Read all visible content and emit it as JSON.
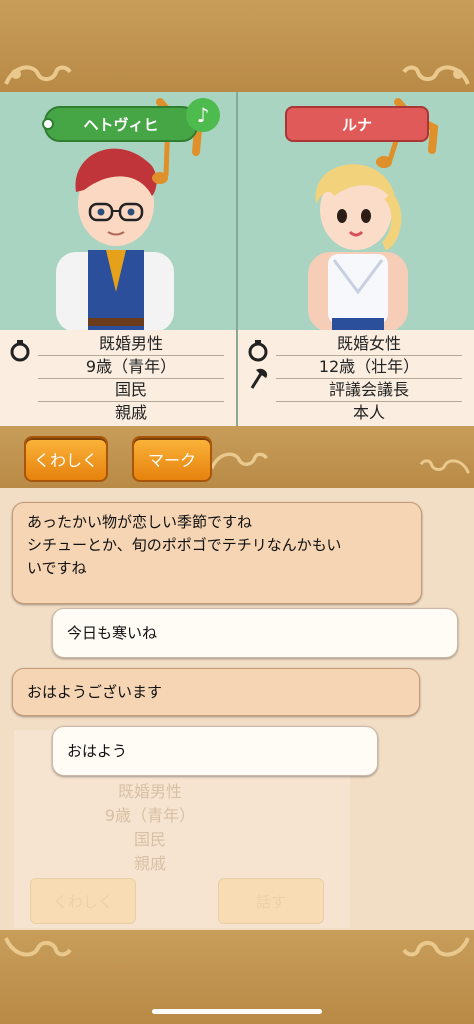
{
  "characters": [
    {
      "name": "ヘトヴィヒ",
      "tag_color": "#46a646",
      "has_note": true,
      "info": [
        "既婚男性",
        "9歳（青年）",
        "国民",
        "親戚"
      ],
      "icons": [
        "ring-icon"
      ]
    },
    {
      "name": "ルナ",
      "tag_color": "#e05a5a",
      "has_note": false,
      "info": [
        "既婚女性",
        "12歳（壮年）",
        "評議会議長",
        "本人"
      ],
      "icons": [
        "ring-icon",
        "axe-icon"
      ]
    }
  ],
  "note_symbol": "♪",
  "buttons": {
    "details": "くわしく",
    "mark": "マーク"
  },
  "chat": [
    {
      "side": "left",
      "style": "brown",
      "text_lines": [
        "あったかい物が恋しい季節ですね",
        "シチューとか、旬のポポゴでテチリなんかもい",
        "いですね"
      ]
    },
    {
      "side": "right",
      "style": "white",
      "text_lines": [
        "今日も寒いね"
      ]
    },
    {
      "side": "left",
      "style": "brown",
      "text_lines": [
        "おはようございます"
      ]
    },
    {
      "side": "right",
      "style": "white",
      "text_lines": [
        "おはよう"
      ]
    }
  ],
  "background_card": {
    "info": [
      "既婚男性",
      "9歳（青年）",
      "国民",
      "親戚"
    ],
    "buttons": [
      "くわしく",
      "話す"
    ]
  }
}
